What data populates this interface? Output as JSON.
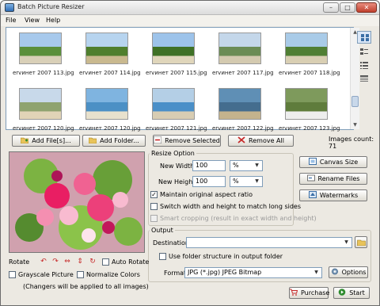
{
  "window": {
    "title": "Batch Picture Resizer",
    "min": "–",
    "max": "□",
    "close": "✕"
  },
  "menu": [
    {
      "label": "File"
    },
    {
      "label": "View"
    },
    {
      "label": "Help"
    }
  ],
  "thumbnails": [
    {
      "label": "ervинет 2007 113.jpg",
      "colors": [
        "#a7c9ec",
        "#5a8f3b",
        "#d9d0b8"
      ]
    },
    {
      "label": "ervинет 2007 114.jpg",
      "colors": [
        "#b7d4ef",
        "#4f7f2e",
        "#c9b98f"
      ]
    },
    {
      "label": "ervинет 2007 115.jpg",
      "colors": [
        "#9dc3ea",
        "#3f7126",
        "#e0d6bb"
      ]
    },
    {
      "label": "ervинет 2007 117.jpg",
      "colors": [
        "#c4d7ea",
        "#6b8c55",
        "#d4cab0"
      ]
    },
    {
      "label": "ervинет 2007 118.jpg",
      "colors": [
        "#a9cbe8",
        "#507f34",
        "#d9cfb3"
      ]
    },
    {
      "label": "ervинет 2007 120.jpg",
      "colors": [
        "#c8d9ea",
        "#8fa36f",
        "#e1d4b7"
      ]
    },
    {
      "label": "ervинет 2007 120.jpg",
      "colors": [
        "#7fb4e0",
        "#4c90c5",
        "#e8e1cd"
      ]
    },
    {
      "label": "ervинет 2007 121.jpg",
      "colors": [
        "#b4cfe6",
        "#4a8fc8",
        "#d8cdb3"
      ]
    },
    {
      "label": "ervинет 2007 122.jpg",
      "colors": [
        "#5f8fb5",
        "#446d8e",
        "#c4b38d"
      ]
    },
    {
      "label": "ervинет 2007 123.jpg",
      "colors": [
        "#7e9a5c",
        "#5f7c3c",
        "#eeeeee"
      ]
    }
  ],
  "buttons": {
    "add_files": "Add File[s]...",
    "add_folder": "Add Folder...",
    "remove_selected": "Remove Selected",
    "remove_all": "Remove All",
    "canvas_size": "Canvas Size",
    "rename_files": "Rename Files",
    "watermarks": "Watermarks",
    "options": "Options",
    "purchase": "Purchase",
    "start": "Start"
  },
  "status": {
    "images_count": "Images count: 71"
  },
  "resize": {
    "title": "Resize Option",
    "width_label": "New Width",
    "width_value": "100",
    "width_unit": "%",
    "height_label": "New Height",
    "height_value": "100",
    "height_unit": "%",
    "maintain_ratio": "Maintain original aspect ratio",
    "maintain_ratio_checked": true,
    "switch_sides": "Switch width and height to match long sides",
    "smart_crop": "Smart cropping (result in exact width and height)"
  },
  "output": {
    "title": "Output",
    "destination_label": "Destination",
    "destination_value": "",
    "use_folder_structure": "Use folder structure in output folder",
    "format_label": "Format",
    "format_value": "JPG (*.jpg) JPEG Bitmap"
  },
  "transform": {
    "rotate_label": "Rotate",
    "auto_rotate": "Auto Rotate",
    "grayscale": "Grayscale Picture",
    "normalize": "Normalize Colors",
    "note": "(Changers will be applied to all images)"
  },
  "colors": {
    "window_bg": "#ece9e2",
    "accent_blue": "#2f6db5",
    "remove_red": "#c62828",
    "ok_green": "#2e8b2e"
  },
  "icons": {
    "add_files": "folder-plus-icon",
    "add_folder": "folder-icon",
    "remove_selected": "remove-icon",
    "remove_all": "close-icon",
    "browse": "folder-open-icon",
    "options": "gear-icon",
    "purchase": "cart-icon",
    "start": "play-icon"
  }
}
